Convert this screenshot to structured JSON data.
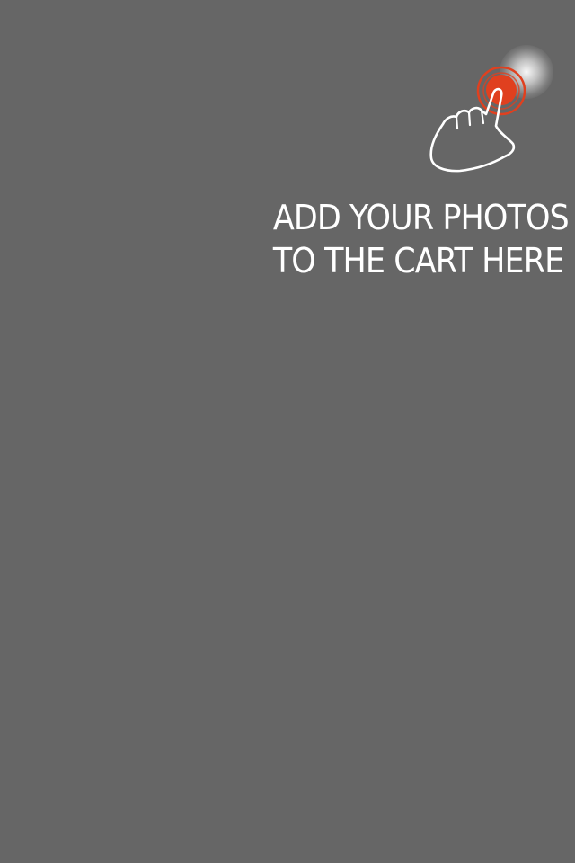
{
  "overlay": {
    "background": "#666666"
  },
  "hint": {
    "line1": "ADD YOUR PHOTOS",
    "line2": "TO THE CART HERE",
    "text_color": "#ffffff"
  },
  "pointer": {
    "icon": "pointing-hand-icon",
    "tap_indicator": "tap-ring-icon",
    "tap_color": "#e0401f",
    "glow_color": "#ffffff"
  }
}
